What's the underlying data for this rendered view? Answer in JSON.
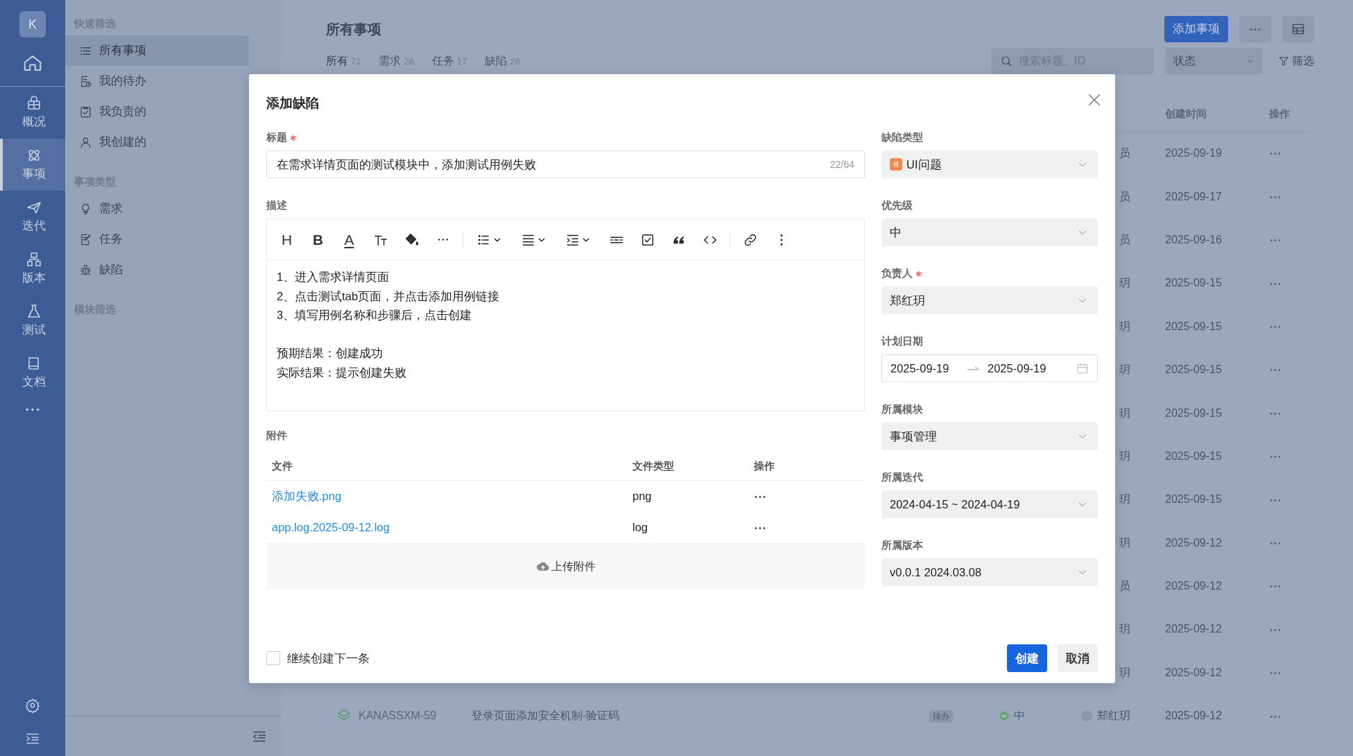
{
  "rail": {
    "logo": "K",
    "items": [
      {
        "label": "概况",
        "selected": false
      },
      {
        "label": "事项",
        "selected": true
      },
      {
        "label": "迭代",
        "selected": false
      },
      {
        "label": "版本",
        "selected": false
      },
      {
        "label": "测试",
        "selected": false
      },
      {
        "label": "文档",
        "selected": false
      }
    ]
  },
  "filter_panel": {
    "sections": [
      {
        "heading": "快速筛选",
        "items": [
          {
            "label": "所有事项",
            "selected": true
          },
          {
            "label": "我的待办",
            "selected": false
          },
          {
            "label": "我负责的",
            "selected": false
          },
          {
            "label": "我创建的",
            "selected": false
          }
        ]
      },
      {
        "heading": "事项类型",
        "items": [
          {
            "label": "需求",
            "selected": false
          },
          {
            "label": "任务",
            "selected": false
          },
          {
            "label": "缺陷",
            "selected": false
          }
        ]
      },
      {
        "heading": "模块筛选"
      }
    ]
  },
  "page": {
    "title": "所有事项",
    "add_button": "添加事项",
    "tabs": [
      {
        "label": "所有",
        "count": "71",
        "selected": true
      },
      {
        "label": "需求",
        "count": "26",
        "selected": false
      },
      {
        "label": "任务",
        "count": "17",
        "selected": false
      },
      {
        "label": "缺陷",
        "count": "28",
        "selected": false
      }
    ],
    "search": {
      "placeholder": "搜索标题、ID"
    },
    "status_select": "状态",
    "filter_button": "筛选"
  },
  "table": {
    "columns": [
      "创建时间",
      "操作"
    ],
    "rows": [
      {
        "assignee": "员",
        "created": "2025-09-19"
      },
      {
        "assignee": "员",
        "created": "2025-09-17"
      },
      {
        "assignee": "员",
        "created": "2025-09-16"
      },
      {
        "assignee": "玥",
        "created": "2025-09-15"
      },
      {
        "assignee": "玥",
        "created": "2025-09-15"
      },
      {
        "assignee": "玥",
        "created": "2025-09-15"
      },
      {
        "assignee": "玥",
        "created": "2025-09-15"
      },
      {
        "assignee": "玥",
        "created": "2025-09-15"
      },
      {
        "assignee": "玥",
        "created": "2025-09-15"
      },
      {
        "assignee": "玥",
        "created": "2025-09-12"
      },
      {
        "assignee": "员",
        "created": "2025-09-12"
      },
      {
        "assignee": "玥",
        "created": "2025-09-12"
      },
      {
        "assignee": "玥",
        "created": "2025-09-12"
      },
      {
        "key": "KANASSXM-59",
        "title": "登录页面添加安全机制-验证码",
        "status": "待办",
        "priority": "中",
        "assignee": "郑红玥",
        "created": "2025-09-12"
      }
    ]
  },
  "dialog": {
    "title": "添加缺陷",
    "title_field": {
      "label": "标题",
      "required": true,
      "value": "在需求详情页面的测试模块中，添加测试用例失败",
      "counter": "22/64"
    },
    "description": {
      "label": "描述",
      "toolbar_glyphs": [
        "H",
        "B",
        "A"
      ],
      "steps": [
        "1、进入需求详情页面",
        "2、点击测试tab页面，并点击添加用例链接",
        "3、填写用例名称和步骤后，点击创建"
      ],
      "results": [
        "预期结果：创建成功",
        "实际结果：提示创建失败"
      ]
    },
    "attachments": {
      "label": "附件",
      "columns": [
        "文件",
        "文件类型",
        "操作"
      ],
      "rows": [
        {
          "file": "添加失败.png",
          "type": "png"
        },
        {
          "file": "app.log.2025-09-12.log",
          "type": "log"
        }
      ],
      "upload": "上传附件"
    },
    "side_fields": [
      {
        "kind": "type_select",
        "label": "缺陷类型",
        "required": false,
        "value": "UI问题"
      },
      {
        "kind": "select",
        "label": "优先级",
        "required": false,
        "value": "中"
      },
      {
        "kind": "select",
        "label": "负责人",
        "required": true,
        "value": "郑红玥"
      },
      {
        "kind": "date_range",
        "label": "计划日期",
        "required": false,
        "start": "2025-09-19",
        "end": "2025-09-19"
      },
      {
        "kind": "select",
        "label": "所属模块",
        "required": false,
        "value": "事项管理"
      },
      {
        "kind": "select",
        "label": "所属迭代",
        "required": false,
        "value": "2024-04-15 ~ 2024-04-19"
      },
      {
        "kind": "select",
        "label": "所属版本",
        "required": false,
        "value": "v0.0.1 2024.03.08"
      }
    ],
    "continue": {
      "label": "继续创建下一条",
      "checked": false
    },
    "buttons": [
      {
        "kind": "primary",
        "label": "创建"
      },
      {
        "kind": "secondary",
        "label": "取消"
      }
    ]
  }
}
